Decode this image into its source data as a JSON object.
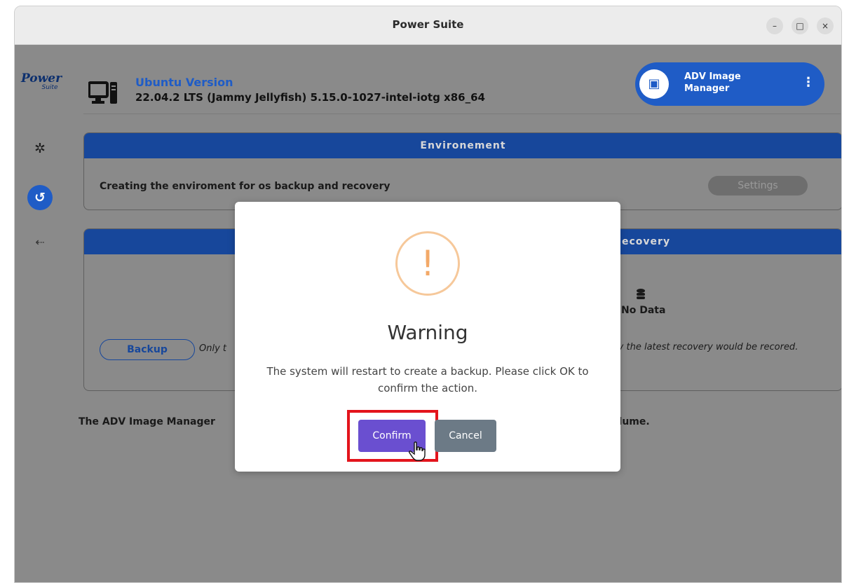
{
  "window": {
    "title": "Power Suite",
    "controls": [
      "–",
      "□",
      "×"
    ]
  },
  "sidebar": {
    "logo_main": "Power",
    "logo_sub": "Suite",
    "items": [
      {
        "icon": "gear-icon",
        "glyph": "✲"
      },
      {
        "icon": "restore-icon",
        "glyph": "↺",
        "active": true
      },
      {
        "icon": "usb-icon",
        "glyph": "⇠"
      }
    ]
  },
  "header": {
    "os_label": "Ubuntu Version",
    "os_value": "22.04.2 LTS (Jammy Jellyfish) 5.15.0-1027-intel-iotg x86_64",
    "app_button_label": "ADV Image Manager",
    "more_glyph": "⋮"
  },
  "environment_panel": {
    "title": "Environement",
    "description": "Creating the enviroment for os backup and recovery",
    "settings_label": "Settings"
  },
  "backup_panel": {
    "title_visible": "ecovery",
    "backup_label": "Backup",
    "only_text": "Only t",
    "no_data": "No Data",
    "recovery_note": "y the latest recovery would be recored."
  },
  "bottom": {
    "text_left": "The ADV Image Manager",
    "text_right": "olume."
  },
  "dialog": {
    "icon_glyph": "!",
    "title": "Warning",
    "message": "The system will restart to create a backup. Please click OK to confirm the action.",
    "confirm_label": "Confirm",
    "cancel_label": "Cancel"
  },
  "colors": {
    "accent": "#1f5cc6",
    "panel_header": "#17479b",
    "confirm": "#6a4fd0",
    "cancel": "#6c7a86",
    "warning": "#f3a968",
    "highlight": "#e3141c"
  }
}
